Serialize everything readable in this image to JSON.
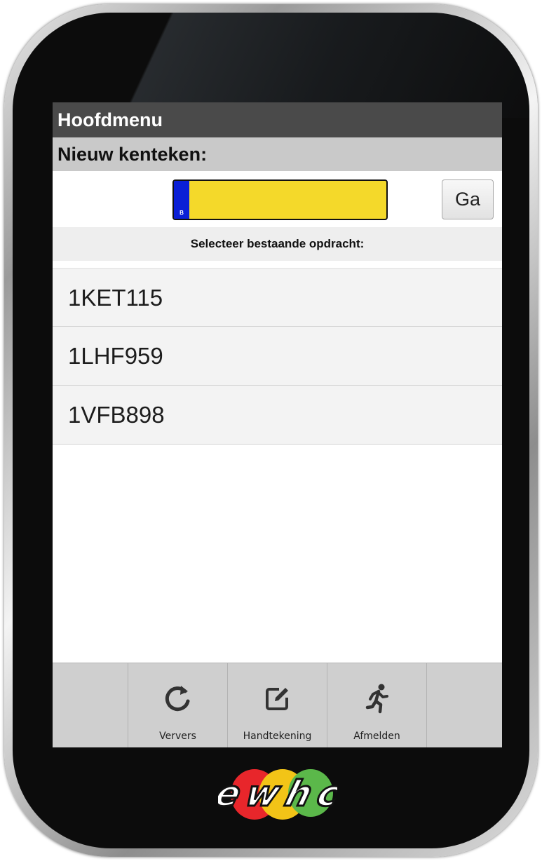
{
  "header": {
    "title": "Hoofdmenu",
    "subtitle": "Nieuw kenteken:"
  },
  "plate": {
    "country_code": "B",
    "value": "",
    "go_label": "Ga"
  },
  "select_caption": "Selecteer bestaande opdracht:",
  "assignments": [
    "1KET115",
    "1LHF959",
    "1VFB898"
  ],
  "toolbar": {
    "items": [
      {
        "label": "Ververs",
        "icon": "refresh-icon"
      },
      {
        "label": "Handtekening",
        "icon": "edit-icon"
      },
      {
        "label": "Afmelden",
        "icon": "running-person-icon"
      }
    ]
  },
  "logo": {
    "text": "ewhc",
    "colors": [
      "#e8262b",
      "#f2c417",
      "#5bb84a"
    ]
  }
}
